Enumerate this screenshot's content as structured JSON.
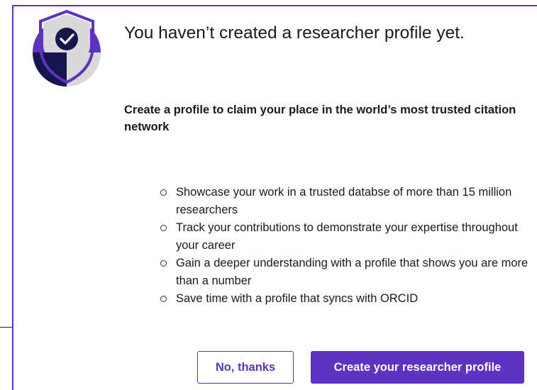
{
  "colors": {
    "accent": "#5e33bf",
    "shield_dark": "#16164d",
    "shield_light": "#d9d9d9",
    "text": "#1a1a1a"
  },
  "modal": {
    "icon": "shield-check-icon",
    "title": "You haven’t created a researcher profile yet.",
    "subtitle": "Create a profile to claim your place in the world’s most trusted citation network",
    "benefits": [
      "Showcase your work in a trusted databse of more than 15 million researchers",
      "Track your contributions to demonstrate your expertise throughout your career",
      "Gain a deeper understanding with a profile that shows you are more than a number",
      "Save time with a profile that syncs with ORCID"
    ],
    "buttons": {
      "decline_label": "No, thanks",
      "create_label": "Create your researcher profile"
    }
  }
}
